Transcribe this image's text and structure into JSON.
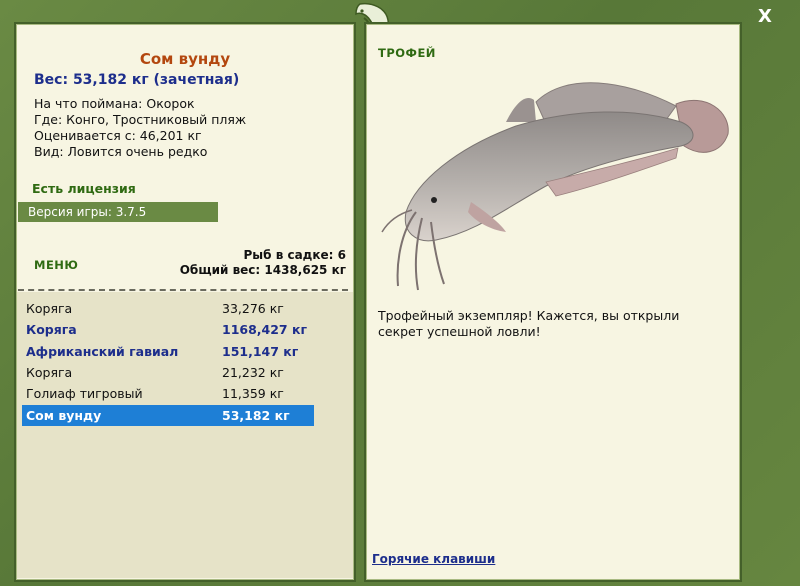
{
  "window": {
    "close_label": "X"
  },
  "fish": {
    "title": "Сом вунду",
    "weight_line": "Вес: 53,182 кг (зачетная)",
    "bait_line": "На что поймана: Окорок",
    "place_line": "Где: Конго, Тростниковый пляж",
    "estimate_line": "Оценивается с: 46,201 кг",
    "kind_line": "Вид: Ловится очень редко"
  },
  "license": "Есть лицензия",
  "version": "Версия игры: 3.7.5",
  "menu_label": "МЕНЮ",
  "stats": {
    "count_line": "Рыб в садке: 6",
    "total_line": "Общий вес: 1438,625 кг"
  },
  "catch_list": [
    {
      "name": "Коряга",
      "weight": "33,276 кг"
    },
    {
      "name": "Коряга",
      "weight": "1168,427 кг"
    },
    {
      "name": "Африканский гавиал",
      "weight": "151,147 кг"
    },
    {
      "name": "Коряга",
      "weight": "21,232 кг"
    },
    {
      "name": "Голиаф тигровый",
      "weight": "11,359 кг"
    },
    {
      "name": "Сом вунду",
      "weight": "53,182 кг"
    }
  ],
  "trophy": {
    "label": "ТРОФЕЙ",
    "text": "Трофейный экземпляр! Кажется, вы открыли секрет успешной ловли!"
  },
  "hotkeys_link": "Горячие клавиши",
  "colors": {
    "frame_green": "#5f7f3d",
    "panel_bg": "#f7f5e2",
    "title_orange": "#b3470f",
    "navy": "#1d2e8c",
    "selected_blue": "#1e7fd6"
  }
}
